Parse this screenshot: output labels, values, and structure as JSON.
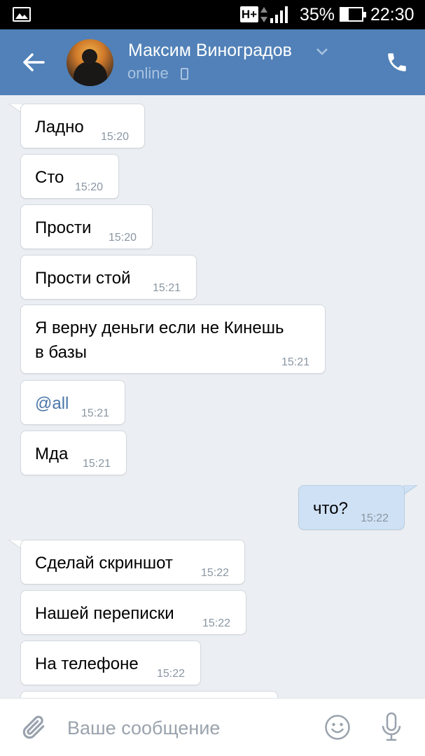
{
  "status_bar": {
    "network": "H+",
    "battery": "35%",
    "battery_level": 0.35,
    "time": "22:30"
  },
  "header": {
    "contact_name": "Максим Виноградов",
    "status": "online"
  },
  "messages": [
    {
      "dir": "in",
      "text": "Ладно",
      "time": "15:20"
    },
    {
      "dir": "in",
      "text": "Сто",
      "time": "15:20"
    },
    {
      "dir": "in",
      "text": "Прости",
      "time": "15:20"
    },
    {
      "dir": "in",
      "text": "Прости стой",
      "time": "15:21"
    },
    {
      "dir": "in",
      "text": "Я верну деньги если не Кинешь",
      "text2": "в базы",
      "time": "15:21"
    },
    {
      "dir": "in",
      "text": "@all",
      "time": "15:21"
    },
    {
      "dir": "in",
      "text": "Мда",
      "time": "15:21"
    },
    {
      "dir": "out",
      "text": "что?",
      "time": "15:22"
    },
    {
      "dir": "in",
      "text": "Сделай скриншот",
      "time": "15:22"
    },
    {
      "dir": "in",
      "text": "Нашей переписки",
      "time": "15:22"
    },
    {
      "dir": "in",
      "text": "На телефоне",
      "time": "15:22"
    }
  ],
  "composer": {
    "placeholder": "Ваше сообщение"
  },
  "colors": {
    "header": "#5181b8",
    "background": "#ebeef2",
    "outgoing_bubble": "#cfe1f4",
    "link": "#4a76a8"
  }
}
